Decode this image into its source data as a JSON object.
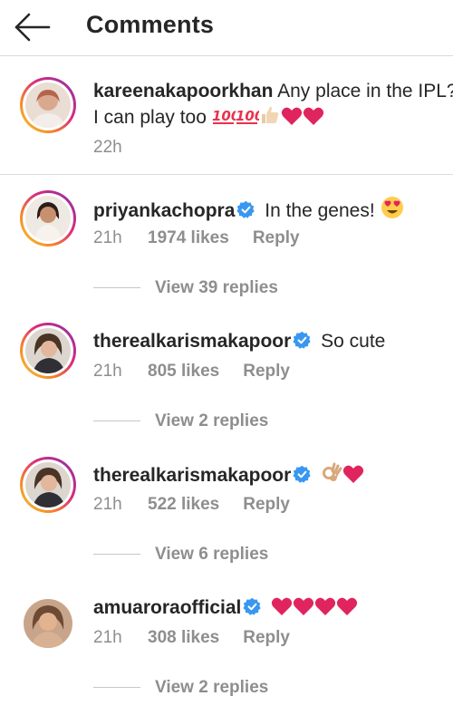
{
  "header": {
    "title": "Comments",
    "back_icon": "arrow-left-icon"
  },
  "caption": {
    "username": "kareenakapoorkhan",
    "text_line1": "Any place in the IPL?",
    "text_line2": "I can play too",
    "emojis": [
      "100",
      "100",
      "thumbs-up",
      "red-heart",
      "red-heart"
    ],
    "time": "22h"
  },
  "comments": [
    {
      "username": "priyankachopra",
      "verified": true,
      "text": "In the genes!",
      "emojis": [
        "heart-eyes"
      ],
      "time": "21h",
      "likes": "1974 likes",
      "reply": "Reply",
      "view_replies": "View 39 replies"
    },
    {
      "username": "therealkarismakapoor",
      "verified": true,
      "text": "So cute",
      "emojis": [],
      "time": "21h",
      "likes": "805 likes",
      "reply": "Reply",
      "view_replies": "View 2 replies"
    },
    {
      "username": "therealkarismakapoor",
      "verified": true,
      "text": "",
      "emojis": [
        "ok-hand",
        "red-heart"
      ],
      "time": "21h",
      "likes": "522 likes",
      "reply": "Reply",
      "view_replies": "View 6 replies"
    },
    {
      "username": "amuaroraofficial",
      "verified": true,
      "text": "",
      "emojis": [
        "red-heart",
        "red-heart",
        "red-heart",
        "red-heart"
      ],
      "time": "21h",
      "likes": "308 likes",
      "reply": "Reply",
      "view_replies": "View 2 replies"
    }
  ],
  "colors": {
    "verified_blue": "#3897f0",
    "heart_red": "#e0245e",
    "meta_gray": "#8e8e8e",
    "divider": "#dbdbdb"
  }
}
